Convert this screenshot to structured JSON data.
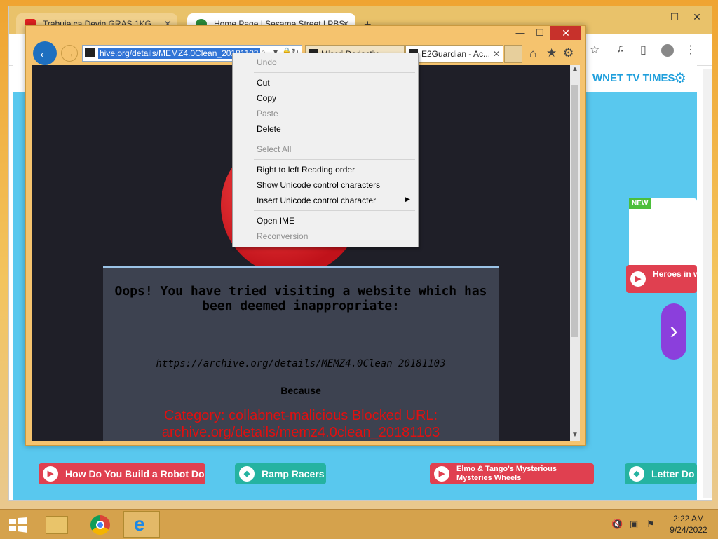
{
  "chrome": {
    "tabs": [
      {
        "label": "Trabuie ca Devin GRAS 1KG"
      },
      {
        "label": "Home Page | Sesame Street | PBS"
      }
    ],
    "new_tab": "+",
    "win_min": "—",
    "win_max": "☐",
    "win_close": "✕"
  },
  "pbs": {
    "header_brand": "WNET TV TIMES",
    "cards": [
      {
        "label": "How Do You Build a Robot Dog"
      },
      {
        "label": "Ramp Racers"
      },
      {
        "label": "Elmo & Tango's Mysterious Mysteries Wheels"
      },
      {
        "label": "Letter Do"
      },
      {
        "label": "Heroes in with Jon B"
      }
    ],
    "new_badge": "NEW",
    "next_arrow": "›"
  },
  "ie": {
    "address_selected": "hive.org/details/MEMZ4.0Clean_20181103",
    "tabs": [
      {
        "label": "Miscri Dedactiv"
      },
      {
        "label": "E2Guardian - Ac..."
      }
    ],
    "tab_close": "✕",
    "win_min": "—",
    "win_max": "☐",
    "win_close": "✕",
    "blocked": {
      "oops": "Oops! You have tried visiting a website which has been deemed inappropriate:",
      "url": "https://archive.org/details/MEMZ4.0Clean_20181103",
      "because": "Because",
      "category": "Category: collabnet-malicious  Blocked URL: archive.org/details/memz4.0clean_20181103"
    }
  },
  "context_menu": {
    "items": [
      {
        "label": "Undo",
        "enabled": false
      },
      {
        "label": "Cut",
        "enabled": true
      },
      {
        "label": "Copy",
        "enabled": true
      },
      {
        "label": "Paste",
        "enabled": false
      },
      {
        "label": "Delete",
        "enabled": true
      },
      {
        "label": "Select All",
        "enabled": false
      },
      {
        "label": "Right to left Reading order",
        "enabled": true
      },
      {
        "label": "Show Unicode control characters",
        "enabled": true
      },
      {
        "label": "Insert Unicode control character",
        "enabled": true
      },
      {
        "label": "Open IME",
        "enabled": true
      },
      {
        "label": "Reconversion",
        "enabled": false
      }
    ]
  },
  "taskbar": {
    "time": "2:22 AM",
    "date": "9/24/2022"
  },
  "colors": {
    "desktop": "#efa431",
    "ie_close": "#c7312b",
    "blocked_category": "#e01010",
    "selection": "#3174d6",
    "pbs_bg": "#59c8ee"
  }
}
